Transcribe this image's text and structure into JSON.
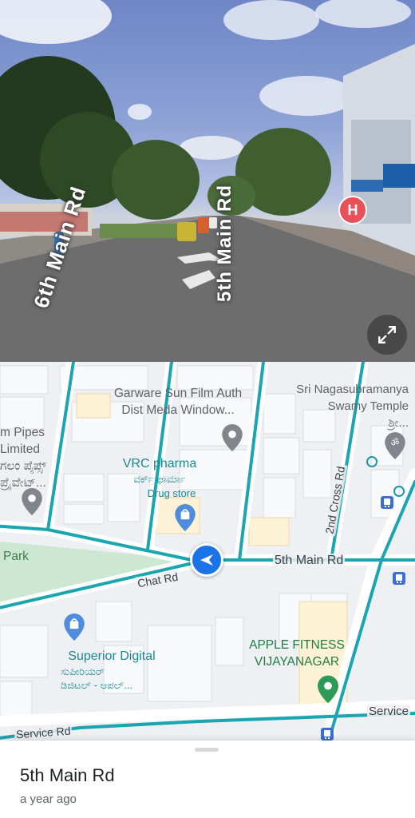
{
  "street_view": {
    "road_label_left": "6th Main Rd",
    "road_label_right": "5th Main Rd",
    "hospital_marker": "H",
    "expand_icon": "expand-icon"
  },
  "map": {
    "places": {
      "garware": "Garware Sun Film Auth\nDist Meda Window...",
      "sri_nagasubramanya": "Sri Nagasubramanya\nSwamy Temple\nಶ್ರೀ...",
      "pipes": "m Pipes\nLimited\nಗಲಂ ಪೈಪ್ಸ್\nಪ್ರೈವೇಟ್...",
      "vrc_name": "VRC pharma",
      "vrc_kn": "ವರ್ಕ್ ಫಾರ್ಮಾ",
      "vrc_type": "Drug store",
      "park": "Park",
      "superior_name": "Superior Digital",
      "superior_kn": "ಸುಪೀರಿಯರ್\nಡಿಜಿಟಲ್ - ಆಪಲ್...",
      "apple_fitness": "APPLE FITNESS\nVIJAYANAGAR"
    },
    "streets": {
      "main": "5th Main Rd",
      "chat": "Chat Rd",
      "cross": "2nd Cross Rd",
      "service_right": "Service",
      "service_left": "Service Rd"
    }
  },
  "sheet": {
    "title": "5th Main Rd",
    "subtitle": "a year ago"
  },
  "colors": {
    "road_highlight": "#1aa5b0",
    "nav_blue": "#1a73e8",
    "park_green": "#cde8d2",
    "pin_grey": "#80868b",
    "pin_teal": "#1a8a90"
  }
}
